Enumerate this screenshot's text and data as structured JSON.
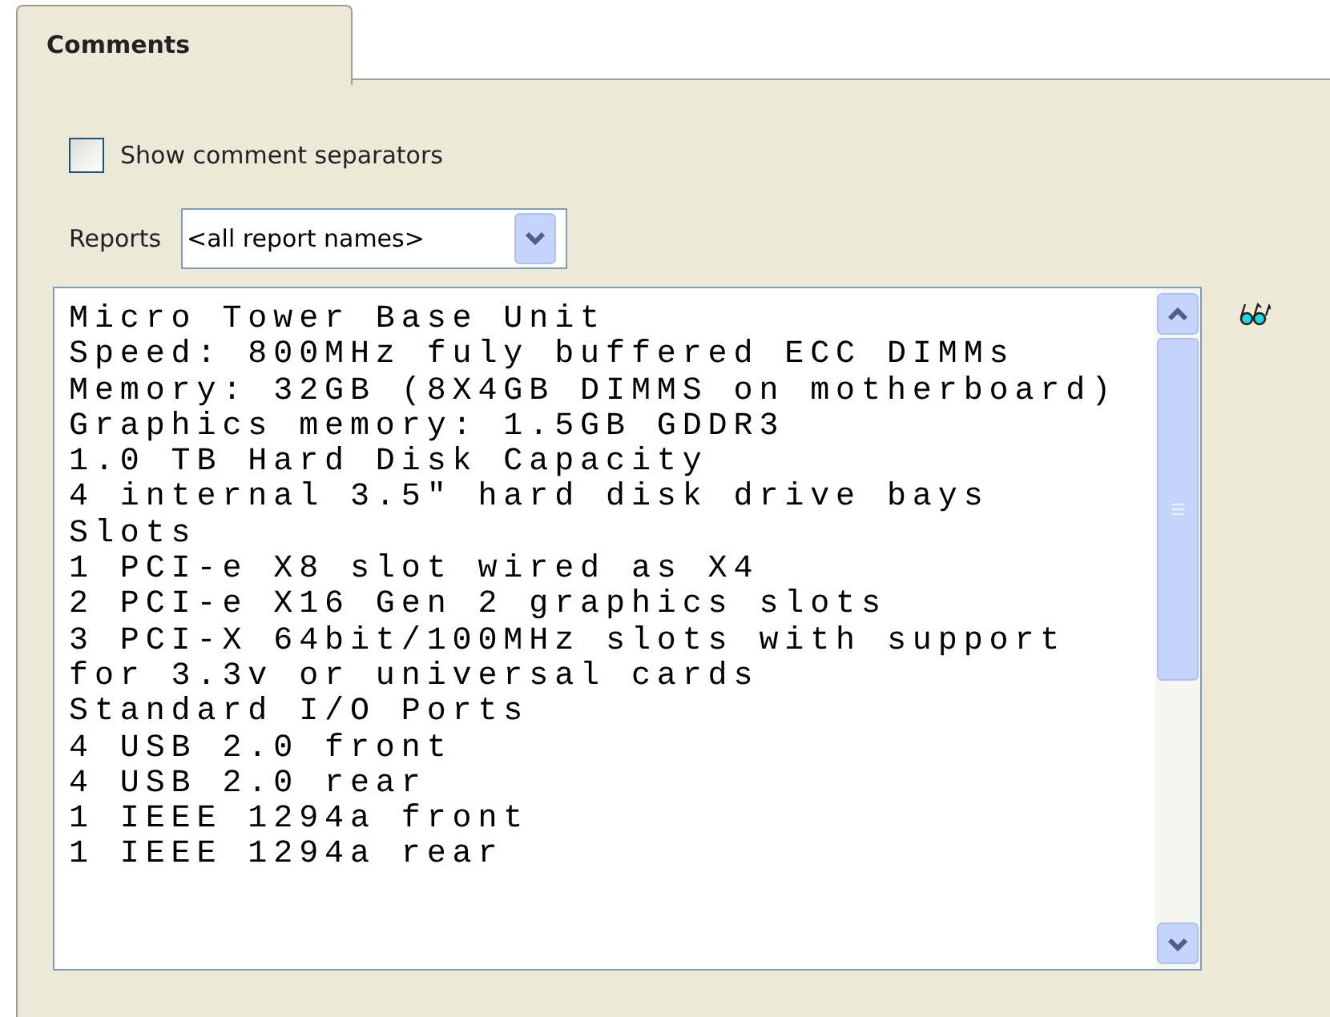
{
  "tabs": [
    {
      "label": "Comments",
      "selected": true
    }
  ],
  "show_comment_separators": {
    "label": "Show comment separators",
    "checked": false
  },
  "reports": {
    "label": "Reports",
    "value": "<all report names>"
  },
  "comments": [
    "Micro Tower Base Unit",
    "Speed: 800MHz fuly buffered ECC DIMMs",
    "Memory: 32GB (8X4GB DIMMS on motherboard)",
    "Graphics memory: 1.5GB GDDR3",
    "1.0 TB Hard Disk Capacity",
    "4 internal 3.5\" hard disk drive bays",
    "Slots",
    "1 PCI-e X8 slot wired as X4",
    "2 PCI-e X16 Gen 2 graphics slots",
    "3 PCI-X 64bit/100MHz slots with support",
    "for 3.3v or universal cards",
    "Standard I/O Ports",
    "4 USB 2.0 front",
    "4 USB 2.0 rear",
    "1 IEEE 1294a front",
    "1 IEEE 1294a rear"
  ]
}
